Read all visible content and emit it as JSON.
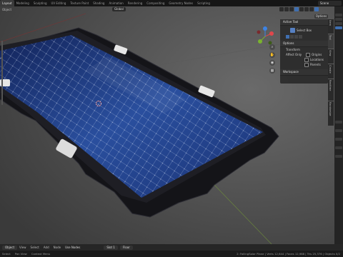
{
  "topbar": {
    "workspaces": [
      "Layout",
      "Modeling",
      "Sculpting",
      "UV Editing",
      "Texture Paint",
      "Shading",
      "Animation",
      "Rendering",
      "Compositing",
      "Geometry Nodes",
      "Scripting"
    ],
    "active_workspace": "Layout",
    "scene": "Scene"
  },
  "header": {
    "object_label": "Object",
    "transform_orientation": "Global",
    "options_label": "Options"
  },
  "npanel": {
    "active_tool_title": "Active Tool",
    "select_box": "Select Box",
    "options_title": "Options",
    "transform_title": "Transform",
    "affect_only": "Affect Only",
    "origins": "Origins",
    "locations": "Locations",
    "parents": "Parents",
    "workspace_title": "Workspace",
    "tabs": [
      "Item",
      "Tool",
      "View",
      "Create",
      "Realtime",
      "Randomize"
    ]
  },
  "timeline": {
    "mode": "Object",
    "menu": [
      "View",
      "Select",
      "Add",
      "Node"
    ],
    "use_nodes": "Use Nodes",
    "slot": "Slot 1",
    "material": "Floor"
  },
  "status": {
    "items": [
      "Select",
      "Pan View",
      "Context Menu"
    ],
    "stats": "2: FallingSolar Plane | Verts 12,644 | Faces 12,988 | Tris 25,376 | Objects 0/2"
  },
  "colors": {
    "accent": "#3f6fb0",
    "panel_cell": "#1c3b86",
    "frame": "#141418",
    "gizmo_x": "#e0474c",
    "gizmo_y": "#7ab32e",
    "gizmo_z": "#3d83e3"
  },
  "icons": {
    "cursor": "cursor-icon",
    "hand": "hand-icon",
    "camera": "camera-icon",
    "grid": "grid-icon",
    "zoom": "zoom-icon"
  }
}
